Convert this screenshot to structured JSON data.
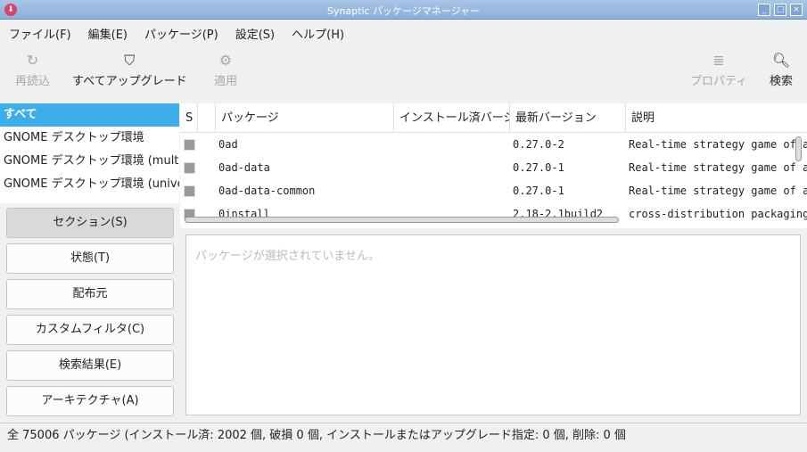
{
  "window": {
    "title": "Synaptic パッケージマネージャー",
    "minimize": "_",
    "maximize": "□",
    "close": "×"
  },
  "menu": [
    "ファイル(F)",
    "編集(E)",
    "パッケージ(P)",
    "設定(S)",
    "ヘルプ(H)"
  ],
  "toolbar": {
    "reload": "再読込",
    "upgrade_all": "すべてアップグレード",
    "apply": "適用",
    "properties": "プロパティ",
    "search": "検索"
  },
  "filters": [
    "すべて",
    "GNOME デスクトップ環境",
    "GNOME デスクトップ環境 (multiverse)",
    "GNOME デスクトップ環境 (universe)"
  ],
  "filter_buttons": [
    "セクション(S)",
    "状態(T)",
    "配布元",
    "カスタムフィルタ(C)",
    "検索結果(E)",
    "アーキテクチャ(A)"
  ],
  "columns": [
    "S",
    "",
    "パッケージ",
    "インストール済バージョン",
    "最新バージョン",
    "説明"
  ],
  "packages": [
    {
      "name": "0ad",
      "installed": "",
      "latest": "0.27.0-2",
      "desc": "Real-time strategy game of ancient warfare"
    },
    {
      "name": "0ad-data",
      "installed": "",
      "latest": "0.27.0-1",
      "desc": "Real-time strategy game of ancient warfare"
    },
    {
      "name": "0ad-data-common",
      "installed": "",
      "latest": "0.27.0-1",
      "desc": "Real-time strategy game of ancient warfare"
    },
    {
      "name": "0install",
      "installed": "",
      "latest": "2.18-2.1build2",
      "desc": "cross-distribution packaging system"
    }
  ],
  "details_placeholder": "パッケージが選択されていません。",
  "status": "全 75006 パッケージ (インストール済: 2002 個, 破損 0 個, インストールまたはアップグレード指定: 0 個, 削除: 0 個"
}
